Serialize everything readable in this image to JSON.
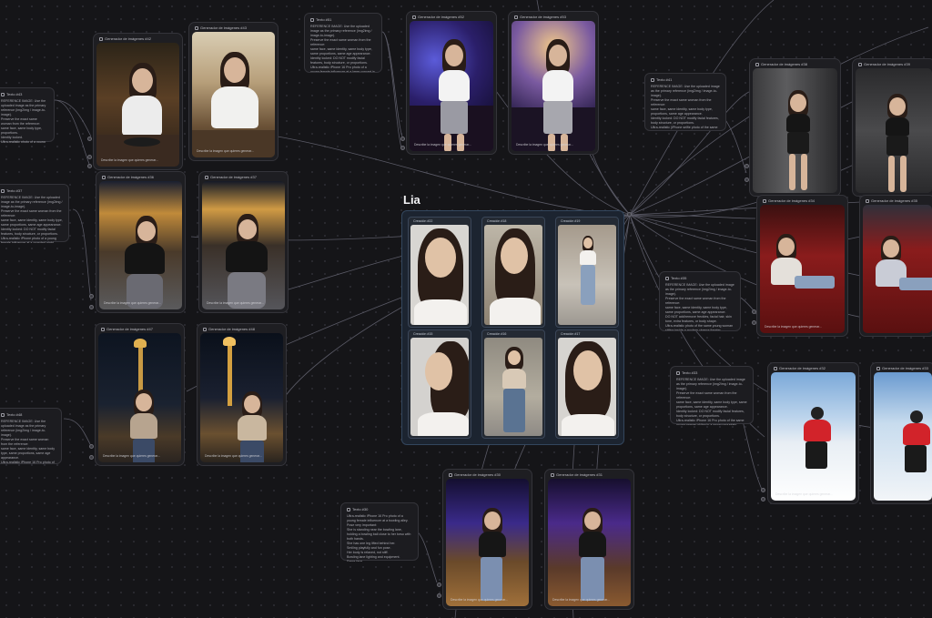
{
  "group": {
    "title": "Lia",
    "cells": [
      "Creación #22",
      "Creación #18",
      "Creación #19",
      "Creación #15",
      "Creación #16",
      "Creación #17"
    ]
  },
  "nodes": {
    "n_restaurant": "Generador de imágenes #42",
    "n_restaurant2": "Generador de imágenes #43",
    "n_concert": "Generador de imágenes #52",
    "n_concert2": "Generador de imágenes #53",
    "n_gym": "Generador de imágenes #38",
    "n_gym2": "Generador de imágenes #39",
    "n_street": "Generador de imágenes #36",
    "n_street2": "Generador de imágenes #37",
    "n_cinema": "Generador de imágenes #34",
    "n_cinema2": "Generador de imágenes #35",
    "n_angel": "Generador de imágenes #47",
    "n_angel2": "Generador de imágenes #48",
    "n_ski": "Generador de imágenes #32",
    "n_ski2": "Generador de imágenes #33",
    "n_bowling": "Generador de imágenes #30",
    "n_bowling2": "Generador de imágenes #31"
  },
  "caption": "Describe la imagen que quieres generar...",
  "texts": [
    {
      "title": "Texto #51",
      "body": "REFERENCE IMAGE: Use the uploaded image as the primary reference (img2img / image-to-image).\nPreserve the exact same woman from the reference:\nsame face, same identity, same body type, same proportions, same age appearance.\nIdentity locked: DO NOT modify facial features, body structure, or proportions.\nUltra-realistic iPhone 16 Pro photo of a young female influencer at a large concert in nightclub venue."
    },
    {
      "title": "Texto #41",
      "body": "REFERENCE IMAGE: Use the uploaded image as the primary reference (img2img / image-to-image).\nPreserve the exact same woman from the reference:\nsame face, same identity, same body type,\nproportions, same age appearance.\nIdentity locked: DO NOT modify facial features, body structure, or proportions.\nUltra-realistic (iPhone selfie photo of the same young woman standing) at a modern gym."
    },
    {
      "title": "Texto #37",
      "body": "REFERENCE IMAGE: Use the uploaded image as the primary reference (img2img / image-to-image).\nPreserve the exact same woman from the reference:\nsame face, same identity, same body type, same proportions, same age appearance.\nIdentity locked: DO NOT modify facial features, body structure, or proportions.\nUltra-realistic iPhone photo of a young female influencer at a crowded night street."
    },
    {
      "title": "Texto #35",
      "body": "REFERENCE IMAGE: Use the uploaded image as the primary reference (img2img / image-to-image).\nPreserve the exact same woman from the reference:\nsame face, same identity, same body type, same proportions, same age appearance.\nDO NOT add/remove freckles, facial hair, skin tone, extra features, or body shape.\nUltra-realistic photo of the same young woman sitting inside a modern cinema theater."
    },
    {
      "title": "Texto #33",
      "body": "REFERENCE IMAGE: Use the uploaded image as the primary reference (img2img / image-to-image).\nPreserve the exact same woman from the reference:\nsame face, same identity, same body type, same proportions, same age appearance.\nIdentity locked: DO NOT modify facial features, body structure, or proportions.\nUltra-realistic iPhone 16 Pro photo of the same young woman skiing in a snowy mountain.\nShe is leaning into a turn, facing the camera directly.\n• Influencer aesthetic; shot"
    },
    {
      "title": "Texto #30",
      "body": "Ultra-realistic iPhone 16 Pro photo of a young female influencer at a bowling alley.\nPose very important:\nShe is standing near the bowling lane,\nholding a bowling ball close to her torso with both hands.\nShe has one leg lifted behind her.\nSmiling playfully and fun pose.\nHer body is relaxed, not stiff.\nBowling lane lighting and equipment.\nSame face."
    },
    {
      "title": "Texto #48",
      "body": "REFERENCE IMAGE: Use the uploaded image as the primary reference (img2img / image-to-image).\nPreserve the exact same woman from the reference:\nsame face, same identity, same body type, same proportions, same age appearance.\nUltra-realistic iPhone 16 Pro photo of a young female influencer standing in front of the Angel de la Independencia."
    },
    {
      "title": "Texto #43",
      "body": "REFERENCE IMAGE: Use the uploaded image as the primary reference (img2img / image-to-image).\nPreserve the exact same woman from the reference:\nsame face, same body type,\nproportions.\nIdentity locked.\nUltra-realistic photo of a young female influencer eating sushi."
    }
  ]
}
